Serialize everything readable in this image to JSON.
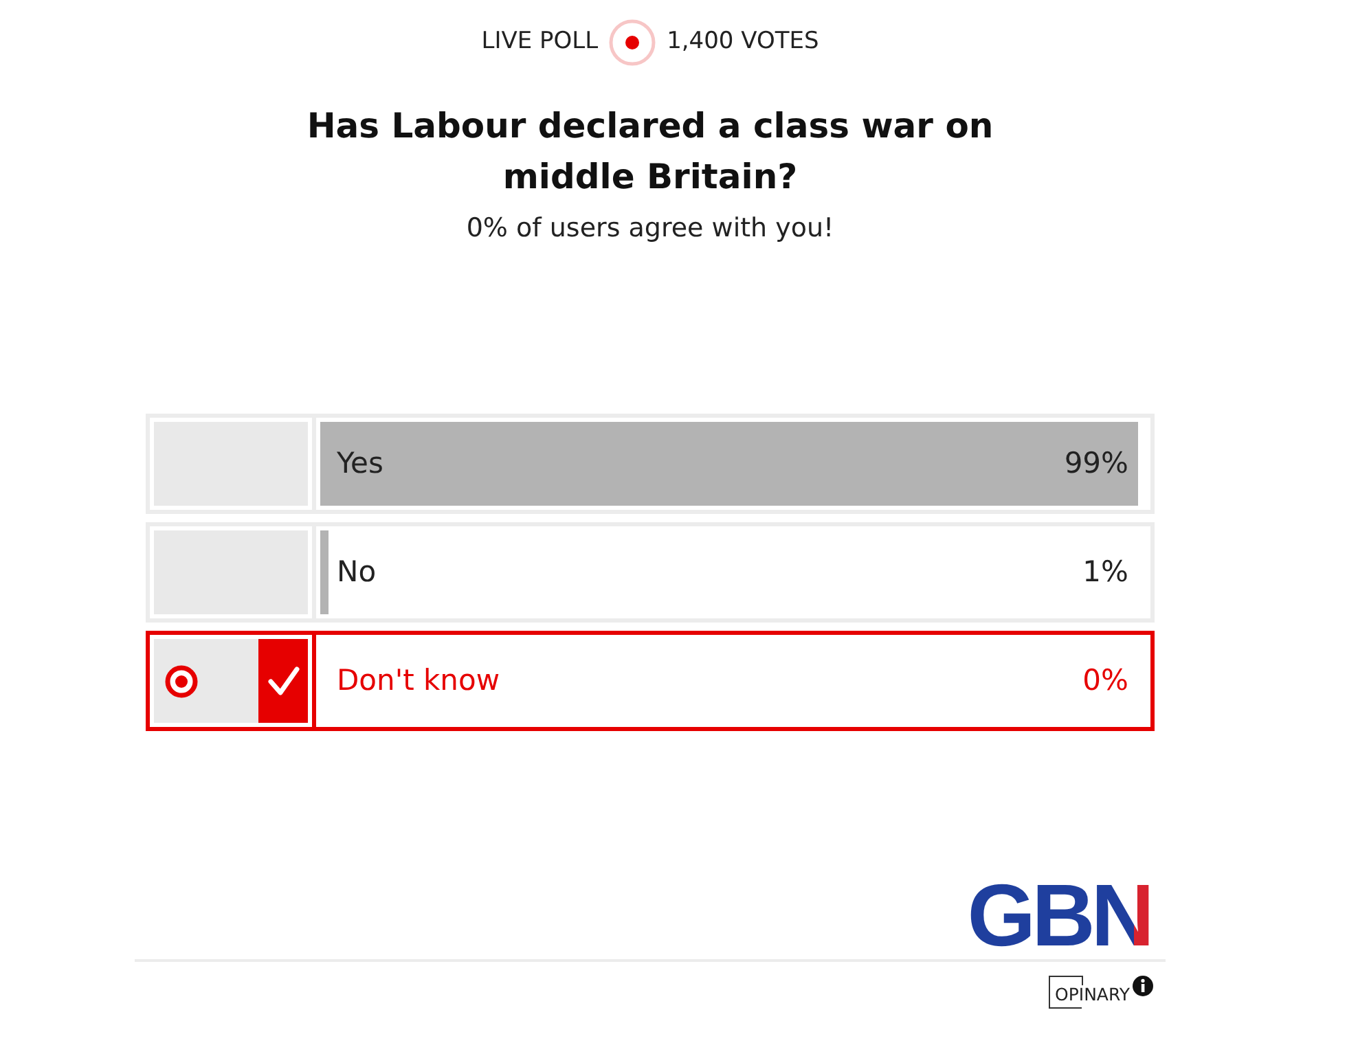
{
  "header": {
    "label": "LIVE POLL",
    "votes": "1,400 VOTES"
  },
  "question": "Has Labour declared a class war on middle Britain?",
  "result_message": "0% of users agree with you!",
  "options": [
    {
      "label": "Yes",
      "percent": "99%",
      "level": 0.99,
      "selected": false
    },
    {
      "label": "No",
      "percent": "1%",
      "level": 0.01,
      "selected": false
    },
    {
      "label": "Don't know",
      "percent": "0%",
      "level": 0,
      "selected": true
    }
  ],
  "footer": {
    "brand": "GBN",
    "provider": "OPINARY"
  }
}
